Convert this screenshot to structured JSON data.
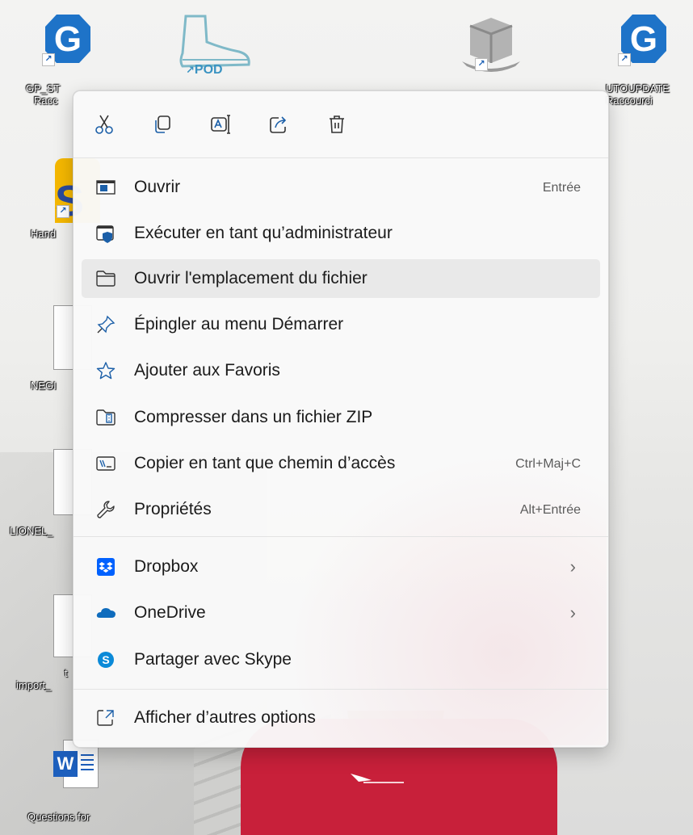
{
  "desktop": {
    "icons": [
      {
        "label_line1": "GP_ST",
        "label_line2": "Racc"
      },
      {
        "label_line1": "POD"
      },
      {
        "label_line1": "UTOUPDATE",
        "label_line2": "Raccourci"
      },
      {
        "label_line1": "Hand"
      },
      {
        "label_line1": "NEGI"
      },
      {
        "label_line1": "LIONEL_"
      },
      {
        "label_line1": "t",
        "label_line2": "import_"
      },
      {
        "label_line1": "Questions for"
      }
    ],
    "shortcut_glyph": "↗",
    "pod_label": "POD",
    "word_letter": "W"
  },
  "context_menu": {
    "quick_actions": [
      {
        "name": "cut-icon"
      },
      {
        "name": "copy-icon"
      },
      {
        "name": "rename-icon"
      },
      {
        "name": "share-icon"
      },
      {
        "name": "delete-icon"
      }
    ],
    "items": [
      {
        "label": "Ouvrir",
        "accelerator": "Entrée",
        "icon": "open-icon"
      },
      {
        "label": "Exécuter en tant qu’administrateur",
        "accelerator": "",
        "icon": "shield-run-icon"
      },
      {
        "label": "Ouvrir l'emplacement du fichier",
        "accelerator": "",
        "icon": "folder-icon"
      },
      {
        "label": "Épingler au menu Démarrer",
        "accelerator": "",
        "icon": "pin-icon"
      },
      {
        "label": "Ajouter aux Favoris",
        "accelerator": "",
        "icon": "star-icon"
      },
      {
        "label": "Compresser dans un fichier ZIP",
        "accelerator": "",
        "icon": "zip-icon"
      },
      {
        "label": "Copier en tant que chemin d’accès",
        "accelerator": "Ctrl+Maj+C",
        "icon": "copy-path-icon"
      },
      {
        "label": "Propriétés",
        "accelerator": "Alt+Entrée",
        "icon": "wrench-icon"
      },
      {
        "label": "Dropbox",
        "accelerator": "",
        "icon": "dropbox-icon",
        "has_submenu": true
      },
      {
        "label": "OneDrive",
        "accelerator": "",
        "icon": "onedrive-icon",
        "has_submenu": true
      },
      {
        "label": "Partager avec Skype",
        "accelerator": "",
        "icon": "skype-icon"
      },
      {
        "label": "Afficher d’autres options",
        "accelerator": "",
        "icon": "more-options-icon"
      }
    ],
    "highlighted_item": "Ouvrir l'emplacement du fichier",
    "chevron": "›"
  },
  "colors": {
    "accent": "#1a5fb4",
    "dropbox": "#0061fe",
    "onedrive": "#0f6cbd",
    "skype": "#0b8ad8",
    "shirt": "#c8203a"
  }
}
